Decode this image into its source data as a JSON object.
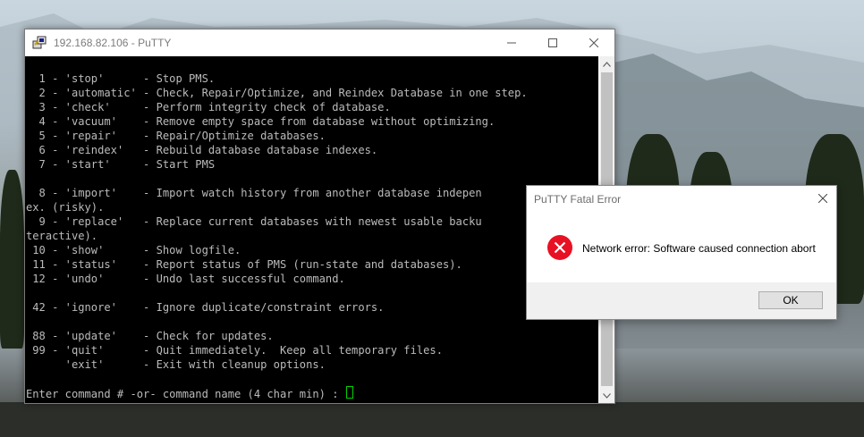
{
  "putty_window": {
    "title": "192.168.82.106 - PuTTY",
    "terminal_lines": [
      "  1 - 'stop'      - Stop PMS.",
      "  2 - 'automatic' - Check, Repair/Optimize, and Reindex Database in one step.",
      "  3 - 'check'     - Perform integrity check of database.",
      "  4 - 'vacuum'    - Remove empty space from database without optimizing.",
      "  5 - 'repair'    - Repair/Optimize databases.",
      "  6 - 'reindex'   - Rebuild database database indexes.",
      "  7 - 'start'     - Start PMS",
      "",
      "  8 - 'import'    - Import watch history from another database indepen",
      "ex. (risky).",
      "  9 - 'replace'   - Replace current databases with newest usable backu",
      "teractive).",
      " 10 - 'show'      - Show logfile.",
      " 11 - 'status'    - Report status of PMS (run-state and databases).",
      " 12 - 'undo'      - Undo last successful command.",
      "",
      " 42 - 'ignore'    - Ignore duplicate/constraint errors.",
      "",
      " 88 - 'update'    - Check for updates.",
      " 99 - 'quit'      - Quit immediately.  Keep all temporary files.",
      "      'exit'      - Exit with cleanup options.",
      ""
    ],
    "prompt": "Enter command # -or- command name (4 char min) : "
  },
  "error_dialog": {
    "title": "PuTTY Fatal Error",
    "message": "Network error: Software caused connection abort",
    "ok_label": "OK"
  },
  "colors": {
    "terminal_bg": "#000000",
    "terminal_text": "#bbbbbb",
    "cursor": "#00d000",
    "error_icon": "#e81123"
  }
}
